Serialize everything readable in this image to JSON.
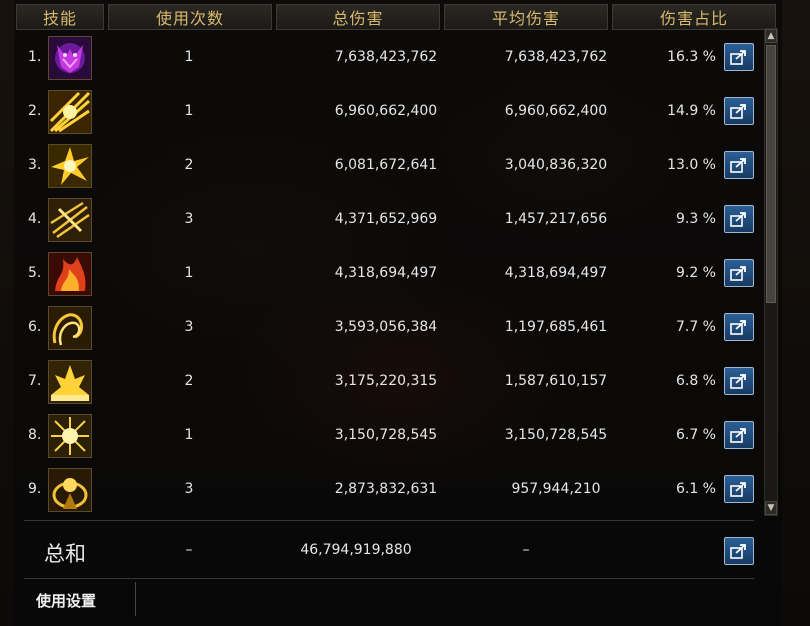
{
  "header": {
    "columns": [
      "技能",
      "使用次数",
      "总伤害",
      "平均伤害",
      "伤害占比"
    ]
  },
  "rows": [
    {
      "rank": "1.",
      "skill_icon": "purple-demon-skill-icon",
      "count": "1",
      "total": "7,638,423,762",
      "average": "7,638,423,762",
      "percent": "16.3 %"
    },
    {
      "rank": "2.",
      "skill_icon": "golden-burst-skill-icon",
      "count": "1",
      "total": "6,960,662,400",
      "average": "6,960,662,400",
      "percent": "14.9 %"
    },
    {
      "rank": "3.",
      "skill_icon": "golden-explosion-skill-icon",
      "count": "2",
      "total": "6,081,672,641",
      "average": "3,040,836,320",
      "percent": "13.0 %"
    },
    {
      "rank": "4.",
      "skill_icon": "golden-slash-skill-icon",
      "count": "3",
      "total": "4,371,652,969",
      "average": "1,457,217,656",
      "percent": "9.3 %"
    },
    {
      "rank": "5.",
      "skill_icon": "red-flame-skill-icon",
      "count": "1",
      "total": "4,318,694,497",
      "average": "4,318,694,497",
      "percent": "9.2 %"
    },
    {
      "rank": "6.",
      "skill_icon": "golden-whirl-skill-icon",
      "count": "3",
      "total": "3,593,056,384",
      "average": "1,197,685,461",
      "percent": "7.7 %"
    },
    {
      "rank": "7.",
      "skill_icon": "golden-eruption-skill-icon",
      "count": "2",
      "total": "3,175,220,315",
      "average": "1,587,610,157",
      "percent": "6.8 %"
    },
    {
      "rank": "8.",
      "skill_icon": "golden-star-skill-icon",
      "count": "1",
      "total": "3,150,728,545",
      "average": "3,150,728,545",
      "percent": "6.7 %"
    },
    {
      "rank": "9.",
      "skill_icon": "golden-aura-skill-icon",
      "count": "3",
      "total": "2,873,832,631",
      "average": "957,944,210",
      "percent": "6.1 %"
    }
  ],
  "summary": {
    "label": "总和",
    "count": "–",
    "total": "46,794,919,880",
    "average": "–"
  },
  "footer": {
    "tab_label": "使用设置"
  },
  "colors": {
    "header_text": "#d9b86c",
    "share_button": "#2b5f96",
    "text": "#e6e6e6"
  },
  "icons": {
    "row_action": "share-icon",
    "scroll_up": "scroll-up-arrow-icon",
    "scroll_down": "scroll-down-arrow-icon"
  }
}
